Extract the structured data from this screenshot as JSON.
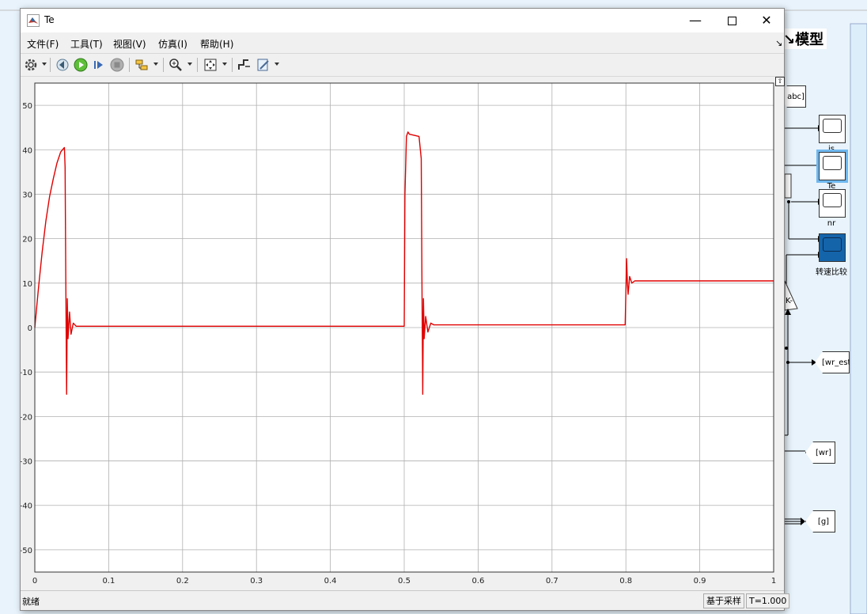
{
  "window": {
    "title": "Te",
    "minimize_icon": "minimize-icon",
    "maximize_icon": "maximize-icon",
    "close_icon": "close-icon"
  },
  "menu": [
    {
      "label": "文件(F)"
    },
    {
      "label": "工具(T)"
    },
    {
      "label": "视图(V)"
    },
    {
      "label": "仿真(I)"
    },
    {
      "label": "帮助(H)"
    }
  ],
  "toolbar": {
    "icons": [
      "gear-icon",
      "step-back-icon",
      "run-icon",
      "step-forward-icon",
      "stop-icon",
      "signal-select-icon",
      "zoom-icon",
      "fit-icon",
      "style-icon",
      "properties-icon"
    ]
  },
  "status": {
    "state": "就绪",
    "sample_mode": "基于采样",
    "time": "T=1.000"
  },
  "model": {
    "title_fragment": "模型",
    "scopes": [
      {
        "label": "is"
      },
      {
        "label": "Te"
      },
      {
        "label": "nr"
      },
      {
        "label": "转速比较"
      }
    ],
    "tags": [
      {
        "label": "abc]"
      },
      {
        "label": "[wr_est]"
      },
      {
        "label": "[wr]"
      },
      {
        "label": "[g]"
      }
    ],
    "gain_label": "K-"
  },
  "chart_data": {
    "type": "line",
    "xlim": [
      0,
      1
    ],
    "ylim": [
      -55,
      55
    ],
    "xticks": [
      0,
      0.1,
      0.2,
      0.3,
      0.4,
      0.5,
      0.6,
      0.7,
      0.8,
      0.9,
      1
    ],
    "yticks": [
      -50,
      -40,
      -30,
      -20,
      -10,
      0,
      10,
      20,
      30,
      40,
      50
    ],
    "grid": true,
    "line_color": "#e00000",
    "series": [
      {
        "x": [
          0,
          0.005,
          0.01,
          0.015,
          0.02,
          0.025,
          0.03,
          0.035,
          0.04,
          0.041,
          0.042,
          0.043,
          0.044,
          0.045,
          0.047,
          0.049,
          0.052,
          0.056,
          0.06,
          0.5,
          0.501,
          0.503,
          0.505,
          0.507,
          0.52,
          0.523,
          0.524,
          0.525,
          0.526,
          0.527,
          0.529,
          0.532,
          0.536,
          0.54,
          0.799,
          0.8,
          0.801,
          0.802,
          0.803,
          0.805,
          0.808,
          0.812,
          1.0
        ],
        "y": [
          0,
          9,
          17,
          24,
          29.5,
          33.5,
          37,
          39.5,
          40.5,
          36,
          10,
          -15,
          6.5,
          -2.5,
          3.5,
          -1.5,
          1,
          0.3,
          0.3,
          0.3,
          30,
          43,
          44,
          43.5,
          43,
          38,
          10,
          -15,
          6.5,
          -2.5,
          2.5,
          -1,
          1,
          0.6,
          0.6,
          8,
          15.5,
          10,
          7.5,
          11.5,
          10,
          10.5,
          10.5
        ]
      }
    ]
  }
}
